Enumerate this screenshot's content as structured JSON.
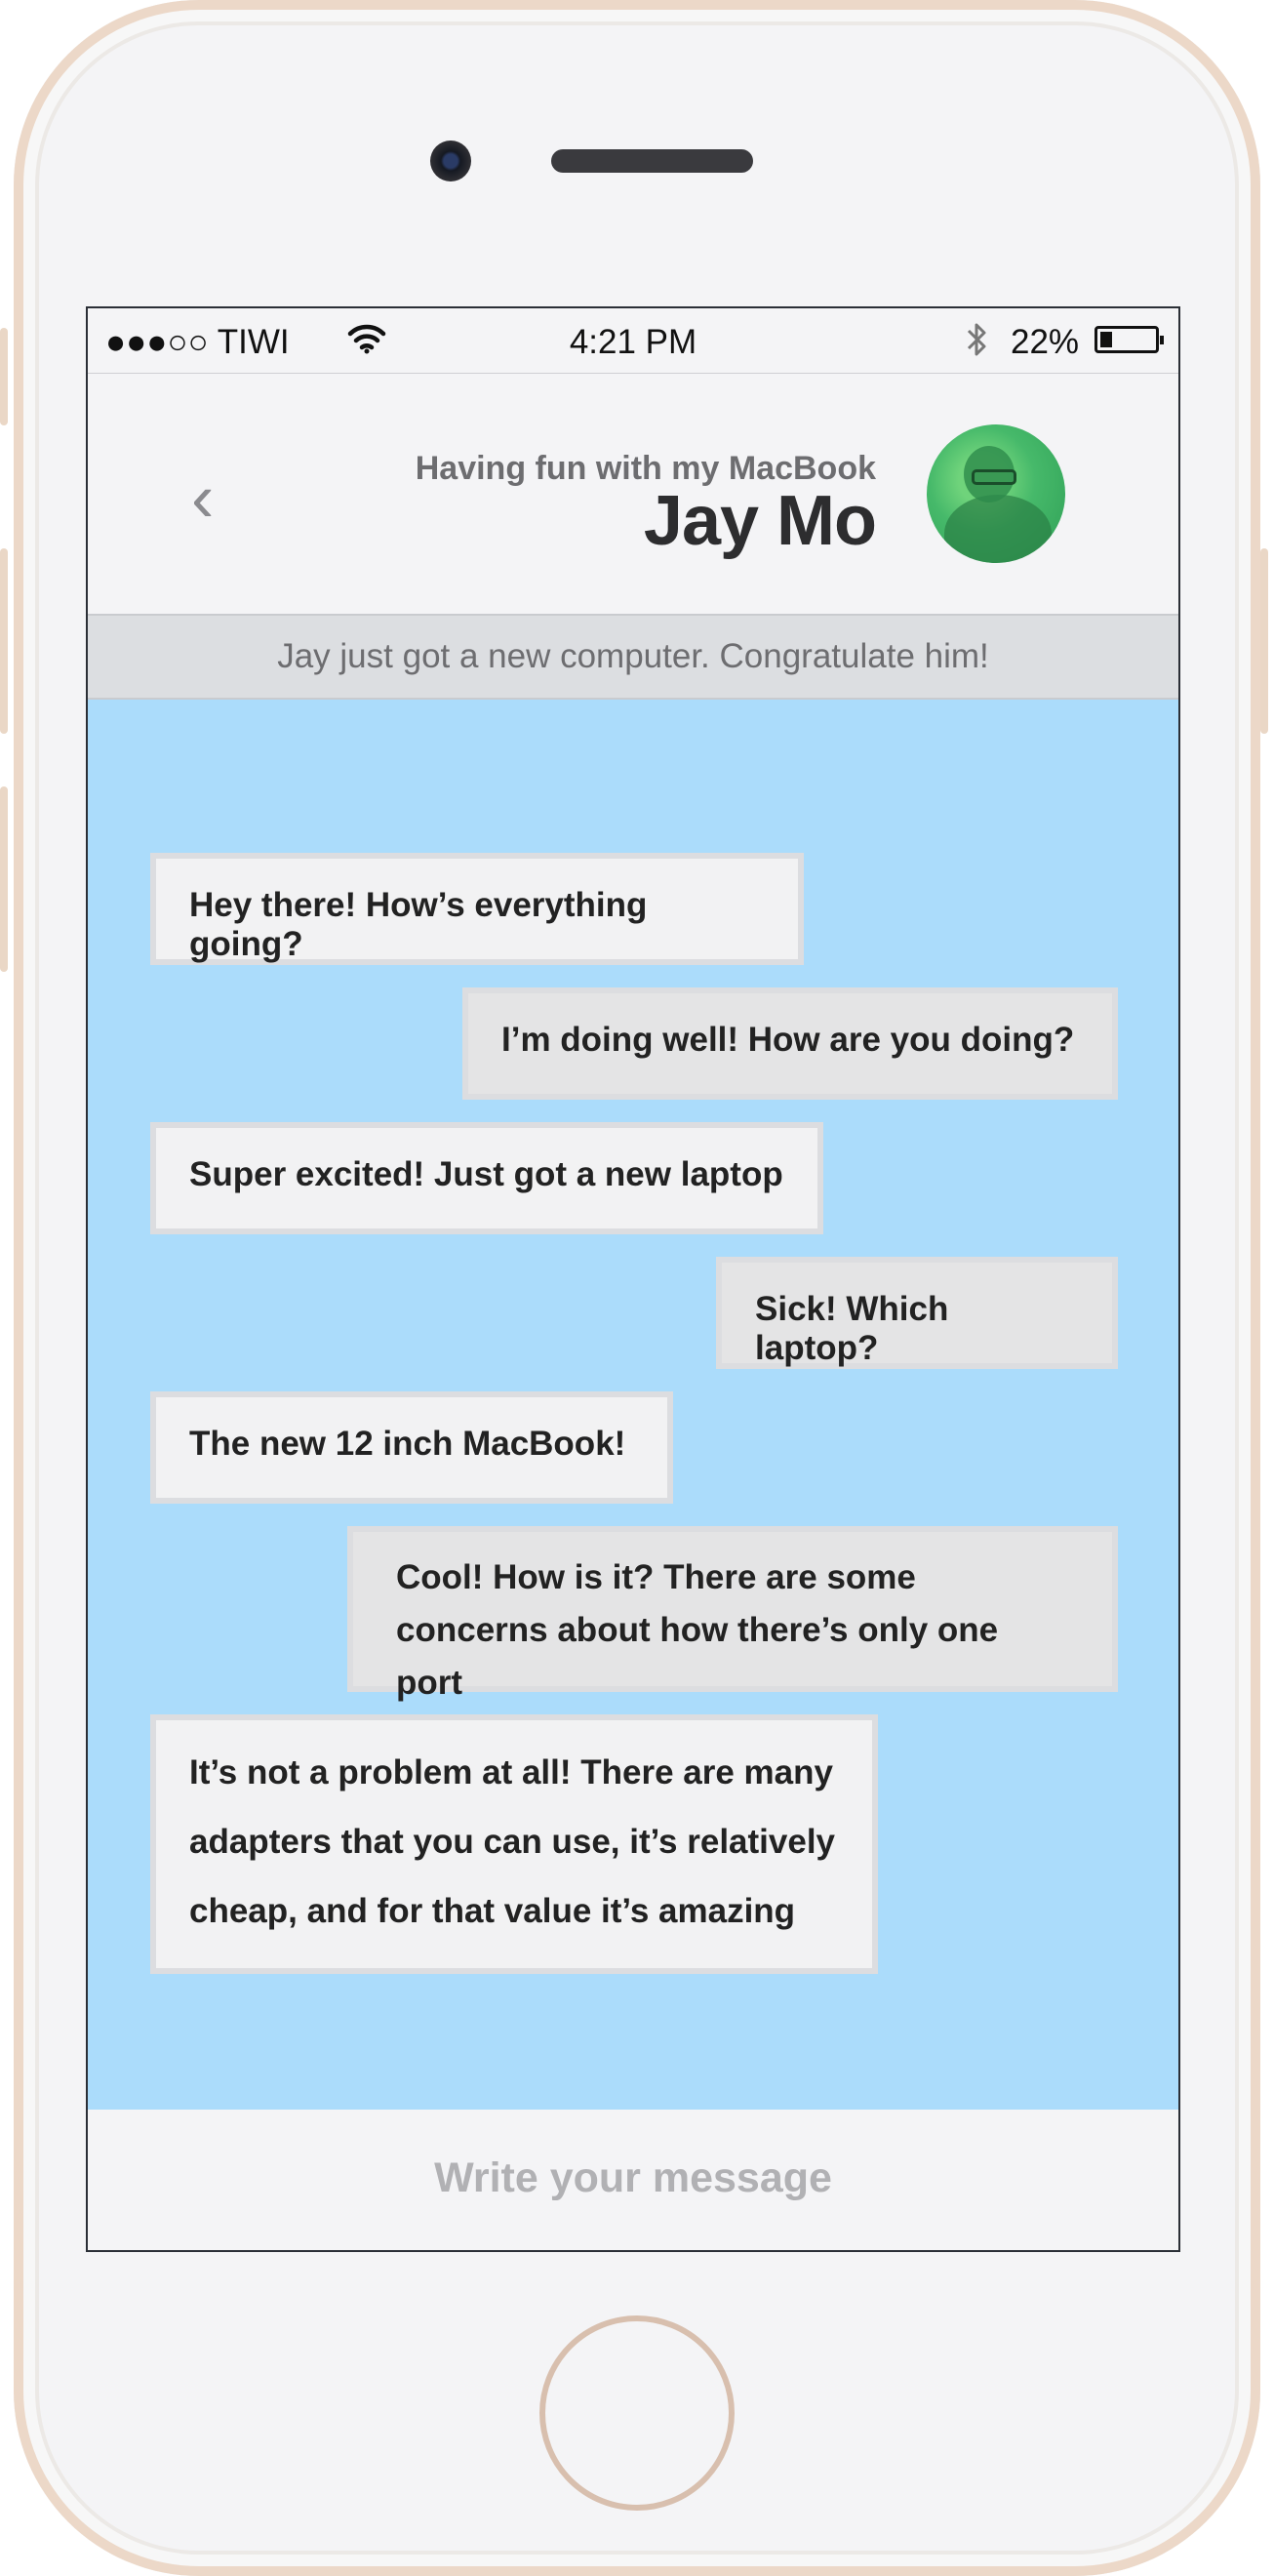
{
  "status_bar": {
    "carrier": "●●●○○ TIWI",
    "time": "4:21 PM",
    "battery_percent": "22%",
    "battery_level": 0.22
  },
  "header": {
    "back_glyph": "‹",
    "subtitle": "Having fun with my MacBook",
    "name": "Jay Mo"
  },
  "banner": {
    "text": "Jay just got a new computer. Congratulate him!"
  },
  "messages": [
    {
      "side": "in",
      "text": "Hey there! How’s everything going?"
    },
    {
      "side": "out",
      "text": "I’m doing well! How are you doing?"
    },
    {
      "side": "in",
      "text": "Super excited! Just got a new laptop"
    },
    {
      "side": "out",
      "text": "Sick! Which laptop?"
    },
    {
      "side": "in",
      "text": "The new 12 inch MacBook!"
    },
    {
      "side": "out",
      "text": "Cool! How is it? There are some concerns about  how there’s only one port"
    },
    {
      "side": "in",
      "text": "It’s not a problem at all! There are many adapters that you can use, it’s relatively cheap, and for that value it’s amazing"
    }
  ],
  "composer": {
    "placeholder": "Write your message"
  },
  "colors": {
    "chat_background": "#abdcfb",
    "bubble_in": "#f2f2f3",
    "bubble_out": "#e4e4e5",
    "phone_frame": "#ecd8c8"
  },
  "icons": [
    "wifi-icon",
    "bluetooth-icon",
    "battery-icon",
    "back-chevron-icon",
    "avatar",
    "home-button"
  ]
}
